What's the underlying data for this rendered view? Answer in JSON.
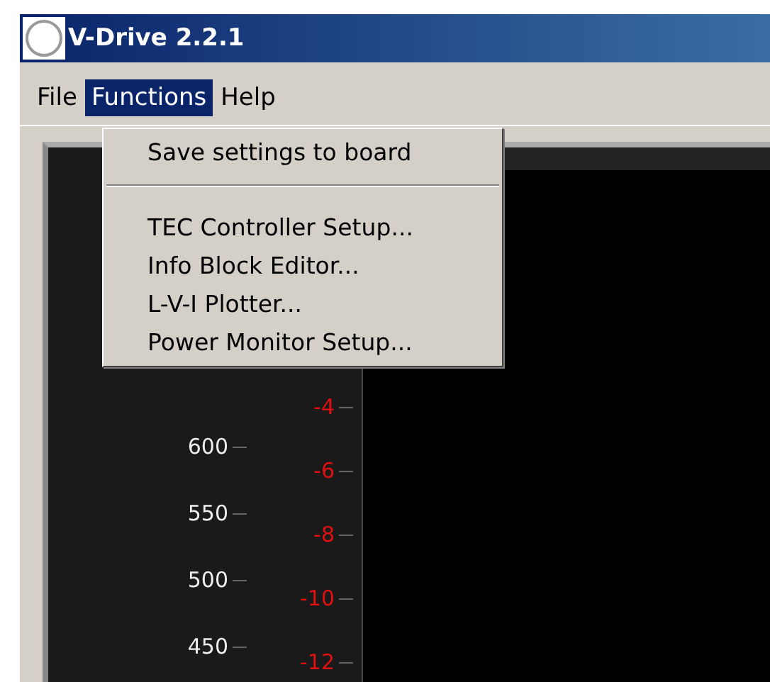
{
  "window": {
    "title": "V-Drive 2.2.1"
  },
  "menu_bar": [
    {
      "label": "File",
      "selected": false
    },
    {
      "label": "Functions",
      "selected": true
    },
    {
      "label": "Help",
      "selected": false
    }
  ],
  "dropdown": {
    "sections": [
      [
        "Save settings to board"
      ],
      [
        "TEC Controller Setup...",
        "Info Block Editor...",
        "L-V-I Plotter...",
        "Power Monitor Setup..."
      ]
    ]
  },
  "scale": {
    "left_labels": [
      "600",
      "550",
      "500",
      "450"
    ],
    "right_labels": [
      "-4",
      "-6",
      "-8",
      "-10",
      "-12"
    ]
  }
}
